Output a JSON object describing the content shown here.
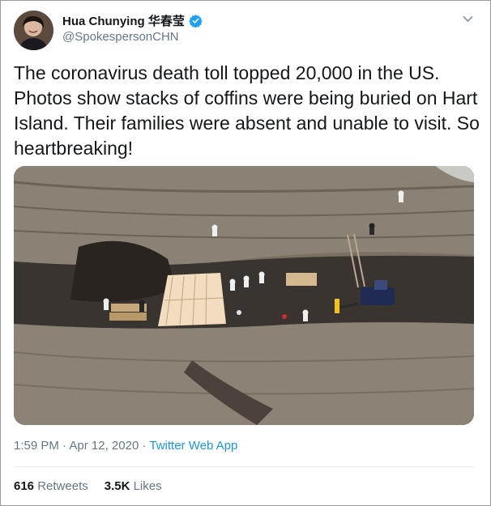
{
  "author": {
    "name": "Hua Chunying 华春莹",
    "handle": "@SpokespersonCHN"
  },
  "tweet": {
    "text": "The coronavirus death toll topped 20,000 in the US. Photos show stacks of coffins were being buried on Hart Island. Their families were absent and unable to visit. So heartbreaking!",
    "time": "1:59 PM",
    "separator": "·",
    "date": "Apr 12, 2020",
    "source": "Twitter Web App"
  },
  "stats": {
    "retweets_count": "616",
    "retweets_label": "Retweets",
    "likes_count": "3.5K",
    "likes_label": "Likes"
  },
  "colors": {
    "accent": "#1b95e0",
    "verified": "#1da1f2",
    "secondary_text": "#657786",
    "primary_text": "#14171a"
  },
  "icons": {
    "verified": "verified-badge-icon",
    "menu": "chevron-down-icon"
  }
}
